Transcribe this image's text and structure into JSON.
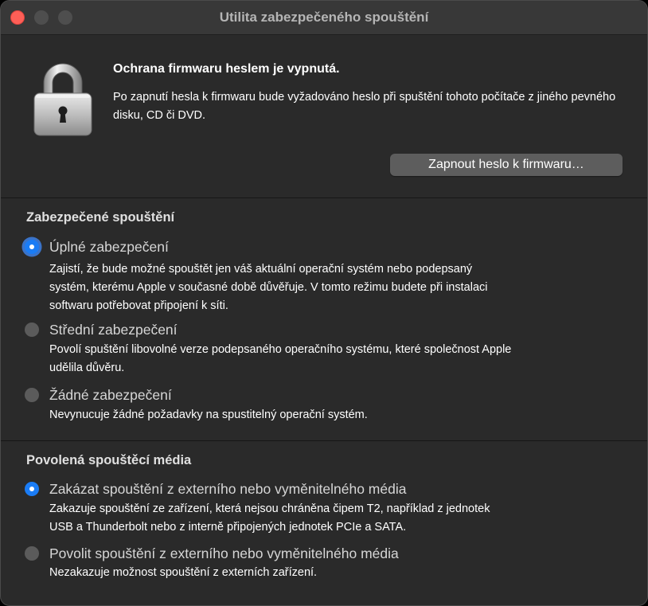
{
  "window": {
    "title": "Utilita zabezpečeného spouštění"
  },
  "firmware": {
    "heading": "Ochrana firmwaru heslem je vypnutá.",
    "description": "Po zapnutí hesla k firmwaru bude vyžadováno heslo při spuštění tohoto počítače z jiného pevného disku, CD či DVD.",
    "button_label": "Zapnout heslo k firmwaru…"
  },
  "secure_boot": {
    "title": "Zabezpečené spouštění",
    "options": [
      {
        "label": "Úplné zabezpečení",
        "description": "Zajistí, že bude možné spouštět jen váš aktuální operační systém nebo podepsaný\nsystém, kterému Apple v současné době důvěřuje. V tomto režimu budete při instalaci\nsoftwaru potřebovat připojení k síti.",
        "selected": true
      },
      {
        "label": "Střední zabezpečení",
        "description": "Povolí spuštění libovolné verze podepsaného operačního systému, které společnost Apple\nudělila důvěru.",
        "selected": false
      },
      {
        "label": "Žádné zabezpečení",
        "description": "Nevynucuje žádné požadavky na spustitelný operační systém.",
        "selected": false
      }
    ]
  },
  "boot_media": {
    "title": "Povolená spouštěcí média",
    "options": [
      {
        "label": "Zakázat spouštění z externího nebo vyměnitelného média",
        "description": "Zakazuje spouštění ze zařízení, která nejsou chráněna čipem T2, například z jednotek\nUSB a Thunderbolt nebo z interně připojených jednotek PCIe a SATA.",
        "selected": true
      },
      {
        "label": "Povolit spouštění z externího nebo vyměnitelného média",
        "description": "Nezakazuje možnost spouštění z externích zařízení.",
        "selected": false
      }
    ]
  },
  "colors": {
    "accent": "#1a7cf5",
    "background": "#2a2a2a",
    "titlebar": "#383838",
    "close_button": "#fe5f57"
  }
}
